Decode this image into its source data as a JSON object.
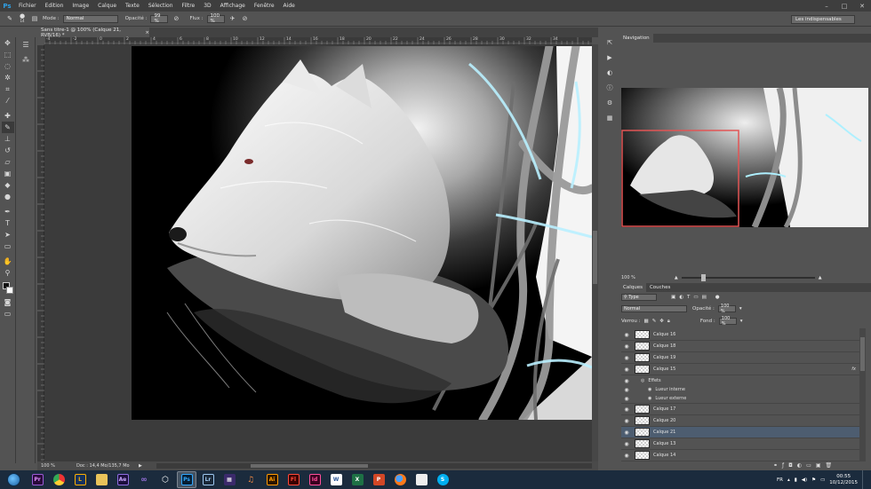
{
  "menubar": {
    "logo": "Ps",
    "items": [
      "Fichier",
      "Edition",
      "Image",
      "Calque",
      "Texte",
      "Sélection",
      "Filtre",
      "3D",
      "Affichage",
      "Fenêtre",
      "Aide"
    ],
    "controls": [
      "–",
      "□",
      "✕"
    ]
  },
  "options": {
    "brush_size": "14",
    "mode_label": "Mode :",
    "mode_value": "Normal",
    "opacity_label": "Opacité :",
    "opacity_value": "99 %",
    "flux_label": "Flux :",
    "flux_value": "100 %",
    "workspace": "Les indispensables"
  },
  "document": {
    "tab_title": "Sans titre-1 @ 100% (Calque 21, RVB/16) *",
    "tab_close": "×",
    "ruler_numbers": [
      "-4",
      "-2",
      "0",
      "2",
      "4",
      "6",
      "8",
      "10",
      "12",
      "14",
      "16",
      "18",
      "20",
      "22",
      "24",
      "26",
      "28",
      "30",
      "32",
      "34"
    ],
    "zoom": "100 %",
    "doc_info": "Doc : 14,4 Mo/135,7 Mo"
  },
  "navigator": {
    "tab": "Navigation",
    "zoom": "100 %"
  },
  "layers": {
    "tab_active": "Calques",
    "tab_other": "Couches",
    "kind_filter": "Type",
    "blend_mode": "Normal",
    "opacity_label": "Opacité :",
    "opacity_value": "100 %",
    "lock_label": "Verrou :",
    "fill_label": "Fond :",
    "fill_value": "100 %",
    "items": [
      {
        "name": "Calque 16"
      },
      {
        "name": "Calque 18"
      },
      {
        "name": "Calque 19"
      },
      {
        "name": "Calque 15",
        "fx": "fx"
      },
      {
        "name": "Calque 17"
      },
      {
        "name": "Calque 20"
      },
      {
        "name": "Calque 21"
      },
      {
        "name": "Calque 13"
      },
      {
        "name": "Calque 14"
      }
    ],
    "effects_label": "Effets",
    "effect_inner": "Lueur interne",
    "effect_outer": "Lueur externe"
  },
  "taskbar": {
    "apps": [
      "Pr",
      "Ae",
      "Lr",
      "Ai",
      "Fl",
      "Id",
      "W",
      "Ps",
      "S"
    ],
    "lang": "FR",
    "time": "00:55",
    "date": "10/12/2015"
  }
}
